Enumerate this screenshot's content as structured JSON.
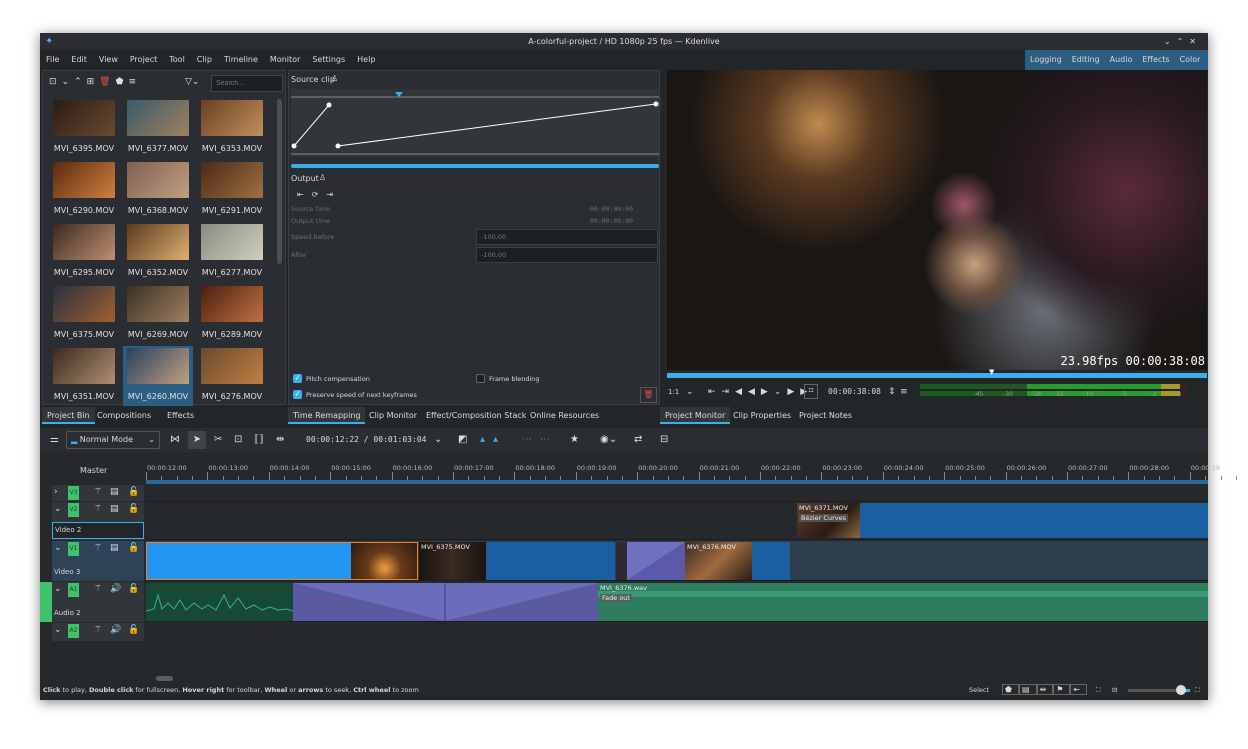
{
  "window": {
    "title": "A-colorful-project / HD 1080p 25 fps — Kdenlive"
  },
  "menu": [
    "File",
    "Edit",
    "View",
    "Project",
    "Tool",
    "Clip",
    "Timeline",
    "Monitor",
    "Settings",
    "Help"
  ],
  "workspaces": [
    "Logging",
    "Editing",
    "Audio",
    "Effects",
    "Color"
  ],
  "bin": {
    "search_placeholder": "Search...",
    "items": [
      "MVI_6395.MOV",
      "MVI_6377.MOV",
      "MVI_6353.MOV",
      "MVI_6290.MOV",
      "MVI_6368.MOV",
      "MVI_6291.MOV",
      "MVI_6295.MOV",
      "MVI_6352.MOV",
      "MVI_6277.MOV",
      "MVI_6375.MOV",
      "MVI_6269.MOV",
      "MVI_6289.MOV",
      "MVI_6351.MOV",
      "MVI_6260.MOV",
      "MVI_6276.MOV"
    ],
    "selected": "MVI_6260.MOV"
  },
  "left_tabs": [
    "Project Bin",
    "Compositions",
    "Effects"
  ],
  "remap": {
    "source_clip": "Source clip",
    "output": "Output",
    "source_time_label": "Source time",
    "source_time": "00:00:00:00",
    "output_time_label": "Output time",
    "output_time": "00:00:00:00",
    "speed_before_label": "Speed before",
    "speed_before": "-100,00",
    "after_label": "After",
    "after": "-100,00",
    "pitch": "Pitch compensation",
    "pitch_checked": true,
    "frame_blending": "Frame blending",
    "frame_blending_checked": false,
    "preserve": "Preserve speed of next keyframes",
    "preserve_checked": true
  },
  "mid_tabs": [
    "Time Remapping",
    "Clip Monitor",
    "Effect/Composition Stack",
    "Online Resources"
  ],
  "monitor": {
    "fps": "23.98fps",
    "timecode_overlay": "00:00:38:08",
    "zoom": "1:1",
    "timecode": "00:00:38:08",
    "meter_ticks": [
      "-45",
      "-30",
      "-20",
      "-15",
      "-10",
      "-5",
      "-2",
      "0"
    ]
  },
  "right_tabs": [
    "Project Monitor",
    "Clip Properties",
    "Project Notes"
  ],
  "timeline": {
    "mode": "Normal Mode",
    "position": "00:00:12:22 / 00:01:03:04",
    "master": "Master",
    "ruler": [
      "00:00:12:00",
      "00:00:13:00",
      "00:00:14:00",
      "00:00:15:00",
      "00:00:16:00",
      "00:00:17:00",
      "00:00:18:00",
      "00:00:19:00",
      "00:00:20:00",
      "00:00:21:00",
      "00:00:22:00",
      "00:00:23:00",
      "00:00:24:00",
      "00:00:25:00",
      "00:00:26:00",
      "00:00:27:00",
      "00:00:28:00",
      "00:00:29"
    ],
    "tracks": {
      "v3": "V3",
      "v2": "V2",
      "v2_name": "Video 2",
      "v1": "V1",
      "v1_name": "Video 3",
      "a1": "A1",
      "a1_name": "Audio 2",
      "a2": "A2"
    },
    "clips": {
      "v2_clip": "MVI_6371.MOV",
      "v2_effect": "Bézier Curves",
      "v1_clip2": "MVI_6375.MOV",
      "v1_clip3": "MVI_6376.MOV",
      "a1_clip": "MVI_6376.wav",
      "a1_effect": "Fade out"
    }
  },
  "status": {
    "hint_html": "<b>Click</b> to play, <b>Double click</b> for fullscreen, <b>Hover right</b> for toolbar, <b>Wheel</b> or <b>arrows</b> to seek, <b>Ctrl wheel</b> to zoom",
    "tool": "Select",
    "zoom_level": 0.85
  },
  "colors": {
    "accent": "#3daee9",
    "selected_clip": "#2196f3",
    "clip_blue": "#1a5fa0",
    "audio_green": "#2e7d5e",
    "composition": "#5e5ea8",
    "track_tag": "#3ec26a"
  }
}
